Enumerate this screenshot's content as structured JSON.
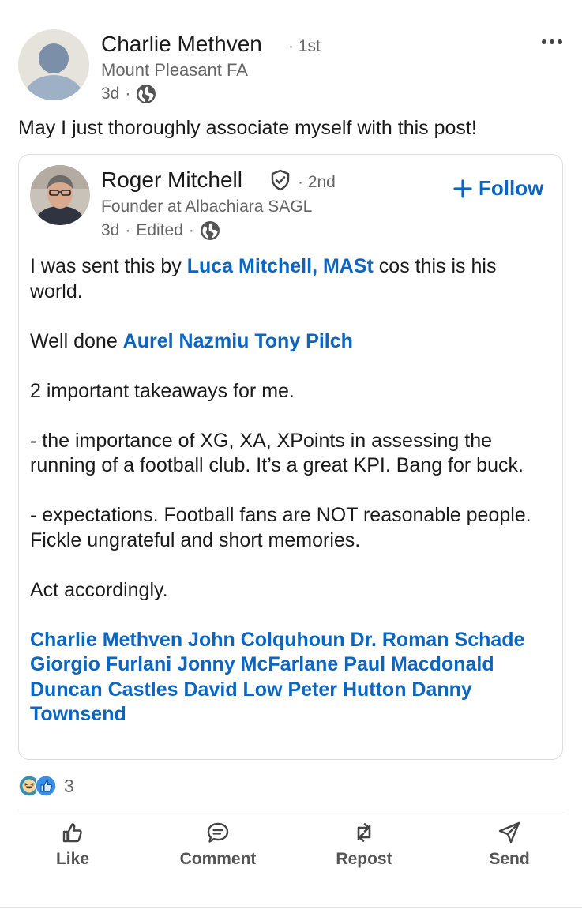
{
  "author": {
    "name": "Charlie Methven",
    "degree": "· 1st",
    "headline": "Mount Pleasant FA",
    "time": "3d",
    "separator": "·"
  },
  "commentary": "May I just thoroughly associate myself with this post!",
  "shared_post": {
    "author": {
      "name": "Roger Mitchell",
      "degree": "· 2nd",
      "headline": "Founder at Albachiara SAGL",
      "time": "3d",
      "edited": "Edited",
      "separator": "·"
    },
    "follow_label": "Follow",
    "body": {
      "p1_a": "I was sent this by ",
      "p1_link": "Luca Mitchell, MASt",
      "p1_b": " cos this is his world.",
      "p2_a": "Well done ",
      "p2_link": "Aurel Nazmiu Tony Pilch",
      "p3": "2 important takeaways for me.",
      "p4": "- the importance of XG, XA, XPoints in assessing the running of a football club. It’s a great KPI. Bang for buck.",
      "p5": "- expectations. Football fans are NOT reasonable people. Fickle ungrateful and short memories.",
      "p6": "Act accordingly.",
      "tags": "Charlie Methven John Colquhoun Dr. Roman Schade Giorgio Furlani Jonny McFarlane Paul Macdonald Duncan Castles David Low Peter Hutton Danny Townsend"
    }
  },
  "reactions": {
    "count": "3",
    "icons": [
      "funny-reaction-icon",
      "like-reaction-icon"
    ]
  },
  "actions": {
    "like": "Like",
    "comment": "Comment",
    "repost": "Repost",
    "send": "Send"
  },
  "colors": {
    "link": "#0a66c2",
    "muted": "#666666",
    "text": "#191919"
  }
}
